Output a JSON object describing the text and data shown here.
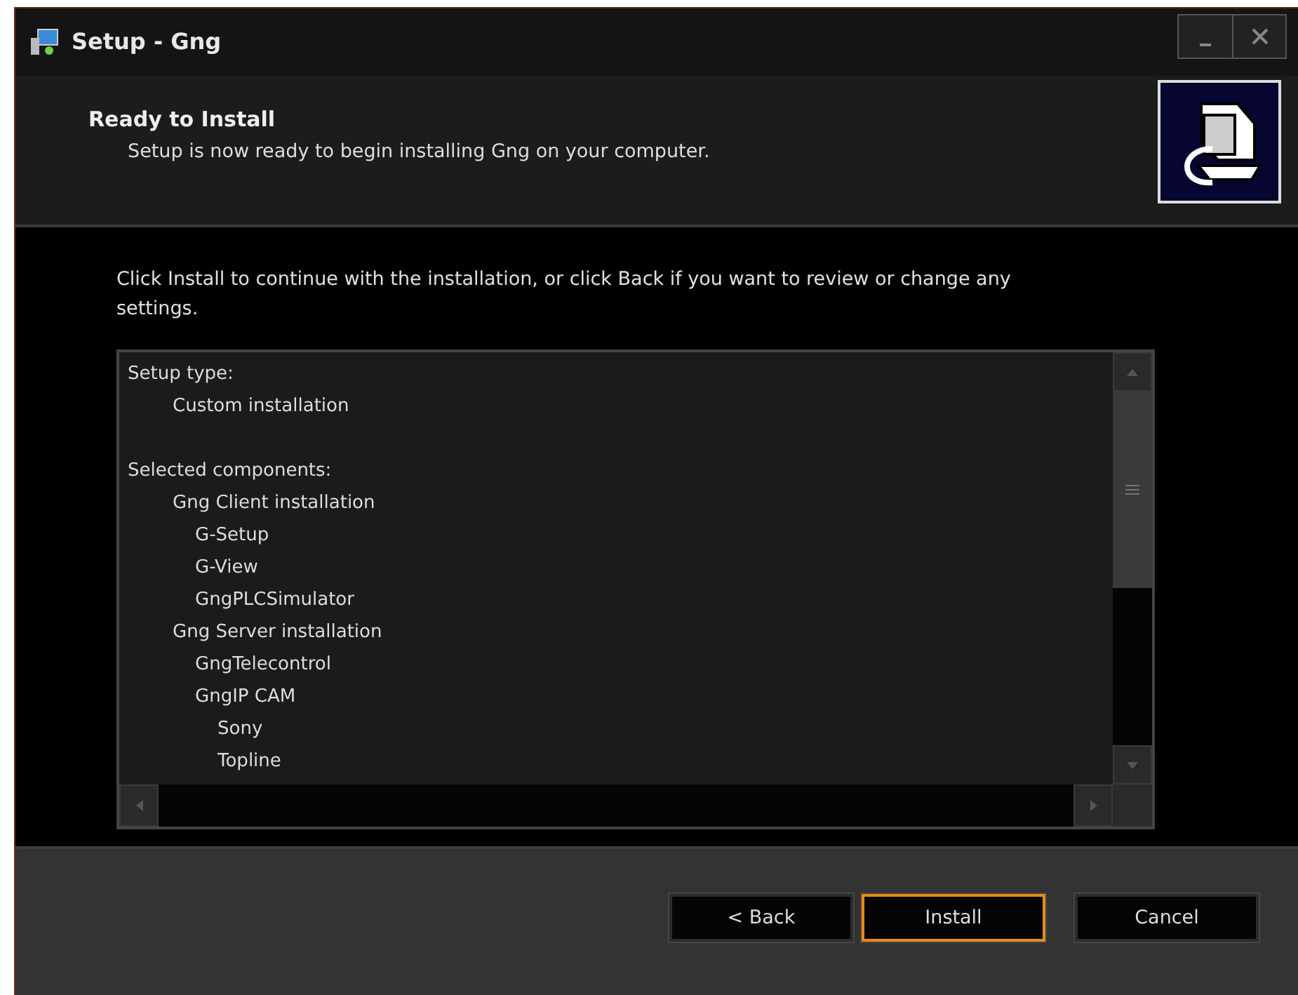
{
  "window": {
    "title": "Setup - Gng"
  },
  "header": {
    "title": "Ready to Install",
    "subtitle": "Setup is now ready to begin installing Gng on your computer."
  },
  "instructions": "Click Install to continue with the installation, or click Back if you want to review or change any settings.",
  "summary": [
    {
      "text": "Setup type:",
      "children": [
        {
          "text": "Custom installation"
        }
      ]
    },
    {
      "text": "Selected components:",
      "children": [
        {
          "text": "Gng Client installation",
          "children": [
            {
              "text": "G-Setup"
            },
            {
              "text": "G-View"
            },
            {
              "text": "GngPLCSimulator"
            }
          ]
        },
        {
          "text": "Gng Server installation",
          "children": [
            {
              "text": "GngTelecontrol"
            },
            {
              "text": "GngIP CAM",
              "children": [
                {
                  "text": "Sony"
                },
                {
                  "text": "Topline"
                }
              ]
            }
          ]
        }
      ]
    }
  ],
  "buttons": [
    {
      "label": "< Back",
      "focused": false
    },
    {
      "label": "Install",
      "focused": true
    },
    {
      "label": "Cancel",
      "focused": false
    }
  ]
}
